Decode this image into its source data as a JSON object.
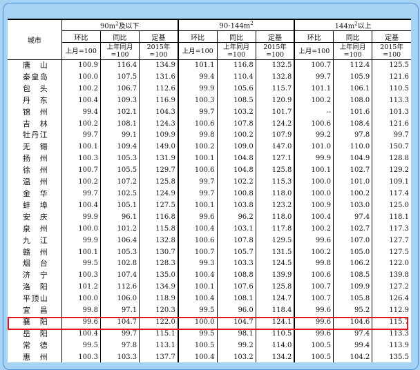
{
  "header": {
    "city_label": "城市",
    "groups": [
      {
        "label_pre": "90m",
        "label_sup": "2",
        "label_post": "及以下"
      },
      {
        "label_pre": "90-144m",
        "label_sup": "2",
        "label_post": ""
      },
      {
        "label_pre": "144m",
        "label_sup": "2",
        "label_post": "以上"
      }
    ],
    "sub": [
      "环比",
      "同比",
      "定基"
    ],
    "base": [
      "上月=100",
      "上年同月=100",
      "2015年=100"
    ]
  },
  "rows": [
    {
      "city": "唐山",
      "v": [
        "100.9",
        "116.4",
        "134.9",
        "101.1",
        "116.8",
        "132.5",
        "100.7",
        "112.4",
        "125.5"
      ]
    },
    {
      "city": "秦皇岛",
      "v": [
        "100.0",
        "107.5",
        "131.6",
        "99.4",
        "110.4",
        "132.8",
        "99.7",
        "105.9",
        "121.6"
      ]
    },
    {
      "city": "包头",
      "v": [
        "100.2",
        "106.7",
        "112.6",
        "99.9",
        "105.6",
        "115.7",
        "101.1",
        "106.1",
        "110.5"
      ]
    },
    {
      "city": "丹东",
      "v": [
        "100.4",
        "109.3",
        "116.9",
        "100.3",
        "108.5",
        "120.9",
        "100.2",
        "108.0",
        "113.3"
      ]
    },
    {
      "city": "锦州",
      "v": [
        "99.4",
        "102.1",
        "104.3",
        "99.7",
        "103.2",
        "101.7",
        "--",
        "101.6",
        "101.3"
      ]
    },
    {
      "city": "吉林",
      "v": [
        "100.2",
        "108.1",
        "124.3",
        "100.6",
        "107.8",
        "124.2",
        "100.6",
        "108.4",
        "121.6"
      ]
    },
    {
      "city": "牡丹江",
      "v": [
        "99.7",
        "99.1",
        "109.9",
        "99.8",
        "100.2",
        "107.9",
        "99.2",
        "97.8",
        "99.7"
      ]
    },
    {
      "city": "无锡",
      "v": [
        "100.1",
        "109.4",
        "149.0",
        "100.2",
        "109.0",
        "147.0",
        "101.0",
        "110.0",
        "150.7"
      ]
    },
    {
      "city": "扬州",
      "v": [
        "100.3",
        "105.3",
        "131.9",
        "100.1",
        "104.8",
        "127.1",
        "99.9",
        "104.9",
        "128.8"
      ]
    },
    {
      "city": "徐州",
      "v": [
        "100.7",
        "105.5",
        "129.7",
        "100.6",
        "104.8",
        "125.8",
        "100.1",
        "102.7",
        "129.2"
      ]
    },
    {
      "city": "温州",
      "v": [
        "100.2",
        "107.2",
        "125.8",
        "99.7",
        "102.2",
        "115.3",
        "100.0",
        "101.0",
        "109.1"
      ]
    },
    {
      "city": "金华",
      "v": [
        "99.7",
        "102.5",
        "124.9",
        "99.7",
        "100.8",
        "118.0",
        "100.0",
        "100.2",
        "117.4"
      ]
    },
    {
      "city": "蚌埠",
      "v": [
        "100.4",
        "105.1",
        "127.5",
        "100.1",
        "103.8",
        "123.2",
        "100.9",
        "103.0",
        "125.0"
      ]
    },
    {
      "city": "安庆",
      "v": [
        "99.9",
        "96.1",
        "116.8",
        "99.6",
        "96.2",
        "118.0",
        "100.4",
        "97.4",
        "118.1"
      ]
    },
    {
      "city": "泉州",
      "v": [
        "100.0",
        "101.2",
        "115.8",
        "100.4",
        "103.1",
        "117.8",
        "100.2",
        "102.7",
        "117.3"
      ]
    },
    {
      "city": "九江",
      "v": [
        "99.9",
        "106.4",
        "132.8",
        "100.6",
        "107.8",
        "129.5",
        "99.6",
        "107.0",
        "127.7"
      ]
    },
    {
      "city": "赣州",
      "v": [
        "100.1",
        "105.3",
        "130.7",
        "100.7",
        "105.7",
        "131.5",
        "100.2",
        "105.0",
        "127.5"
      ]
    },
    {
      "city": "烟台",
      "v": [
        "99.5",
        "102.8",
        "128.3",
        "99.3",
        "103.3",
        "124.5",
        "99.8",
        "106.2",
        "122.0"
      ]
    },
    {
      "city": "济宁",
      "v": [
        "100.3",
        "107.4",
        "135.0",
        "100.4",
        "108.8",
        "139.9",
        "100.6",
        "108.5",
        "139.8"
      ]
    },
    {
      "city": "洛阳",
      "v": [
        "101.2",
        "112.6",
        "134.9",
        "100.1",
        "107.6",
        "125.8",
        "100.7",
        "109.9",
        "127.2"
      ]
    },
    {
      "city": "平顶山",
      "v": [
        "100.0",
        "106.0",
        "118.9",
        "100.4",
        "108.1",
        "124.7",
        "100.7",
        "105.8",
        "126.4"
      ]
    },
    {
      "city": "宜昌",
      "v": [
        "99.8",
        "97.1",
        "120.3",
        "99.5",
        "96.0",
        "118.4",
        "99.6",
        "95.2",
        "112.9"
      ]
    },
    {
      "city": "襄阳",
      "v": [
        "99.6",
        "104.7",
        "122.0",
        "100.0",
        "104.7",
        "124.1",
        "99.6",
        "104.6",
        "115.7"
      ]
    },
    {
      "city": "岳阳",
      "v": [
        "100.4",
        "99.7",
        "115.1",
        "99.5",
        "98.1",
        "110.5",
        "99.6",
        "97.4",
        "113.3"
      ]
    },
    {
      "city": "常德",
      "v": [
        "99.5",
        "97.8",
        "113.1",
        "100.5",
        "99.2",
        "114.0",
        "100.5",
        "99.4",
        "113.9"
      ]
    },
    {
      "city": "惠州",
      "v": [
        "100.3",
        "103.3",
        "137.7",
        "100.4",
        "103.2",
        "134.2",
        "100.5",
        "104.2",
        "135.5"
      ]
    }
  ]
}
